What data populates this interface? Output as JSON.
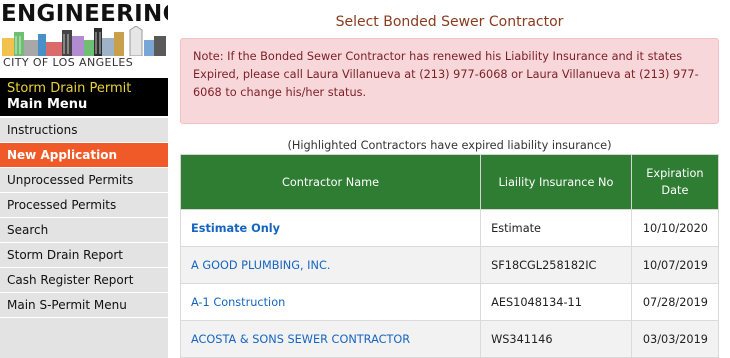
{
  "logo": {
    "title": "ENGINEERING",
    "subtitle": "CITY OF LOS ANGELES"
  },
  "menu": {
    "title_line1": "Storm Drain Permit",
    "title_line2": "Main Menu",
    "items": [
      {
        "label": "Instructions"
      },
      {
        "label": "New Application"
      },
      {
        "label": "Unprocessed Permits"
      },
      {
        "label": "Processed Permits"
      },
      {
        "label": "Search"
      },
      {
        "label": "Storm Drain Report"
      },
      {
        "label": "Cash Register Report"
      },
      {
        "label": "Main S-Permit Menu"
      }
    ],
    "active_index": 1
  },
  "main": {
    "title": "Select Bonded Sewer Contractor",
    "note": "Note: If the Bonded Sewer Contractor has renewed his Liability Insurance and it states Expired, please call Laura Villanueva at (213) 977-6068 or Laura Villanueva at (213) 977-6068 to change his/her status.",
    "hint": "(Highlighted Contractors have expired liability insurance)"
  },
  "table": {
    "headers": {
      "name": "Contractor Name",
      "insurance": "Liaility Insurance No",
      "expiration": "Expiration Date"
    },
    "rows": [
      {
        "name": "Estimate Only",
        "insurance": "Estimate",
        "expiration": "10/10/2020"
      },
      {
        "name": "A GOOD PLUMBING, INC.",
        "insurance": "SF18CGL258182IC",
        "expiration": "10/07/2019"
      },
      {
        "name": "A-1 Construction",
        "insurance": "AES1048134-11",
        "expiration": "07/28/2019"
      },
      {
        "name": "ACOSTA & SONS SEWER CONTRACTOR",
        "insurance": "WS341146",
        "expiration": "03/03/2019"
      }
    ]
  },
  "colors": {
    "header_green": "#2e7d32",
    "active_orange": "#f05a28",
    "note_pink": "#f8d7da",
    "link_blue": "#1565c0"
  }
}
